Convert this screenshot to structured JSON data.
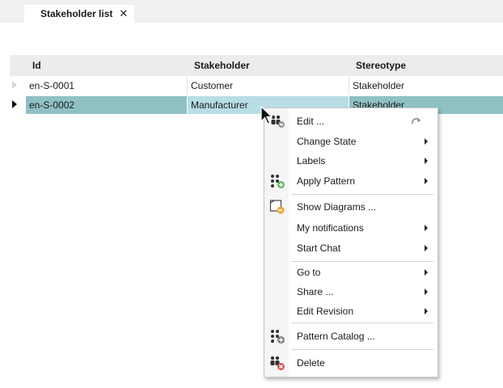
{
  "tab": {
    "title": "Stakeholder list",
    "close_glyph": "✕"
  },
  "grid": {
    "columns": [
      "Id",
      "Stakeholder",
      "Stereotype"
    ],
    "rows": [
      {
        "id": "en-S-0001",
        "stakeholder": "Customer",
        "stereotype": "Stakeholder",
        "selected": false
      },
      {
        "id": "en-S-0002",
        "stakeholder": "Manufacturer",
        "stereotype": "Stakeholder",
        "selected": true
      }
    ]
  },
  "menu": {
    "items": [
      {
        "label": "Edit ...",
        "icon": "edit-people-icon",
        "submenu": false,
        "shortcut_icon": "redo-icon"
      },
      {
        "label": "Change State",
        "submenu": true
      },
      {
        "label": "Labels",
        "submenu": true
      },
      {
        "label": "Apply Pattern",
        "icon": "apply-pattern-icon",
        "submenu": true
      },
      {
        "label": "Show Diagrams ...",
        "icon": "show-diagrams-icon",
        "submenu": false
      },
      {
        "label": "My notifications",
        "submenu": true
      },
      {
        "label": "Start Chat",
        "submenu": true
      },
      {
        "label": "Go to",
        "submenu": true
      },
      {
        "label": "Share ...",
        "submenu": true
      },
      {
        "label": "Edit Revision",
        "submenu": true
      },
      {
        "label": "Pattern Catalog ...",
        "icon": "pattern-catalog-icon",
        "submenu": false
      },
      {
        "label": "Delete",
        "icon": "delete-icon",
        "submenu": false
      }
    ]
  },
  "colors": {
    "selected_row": "#8fc1c4",
    "active_cell": "#b9dde6",
    "header_bg": "#ececec",
    "accent_green": "#5cb85c",
    "accent_orange": "#f0a030",
    "accent_red": "#d9534f"
  }
}
